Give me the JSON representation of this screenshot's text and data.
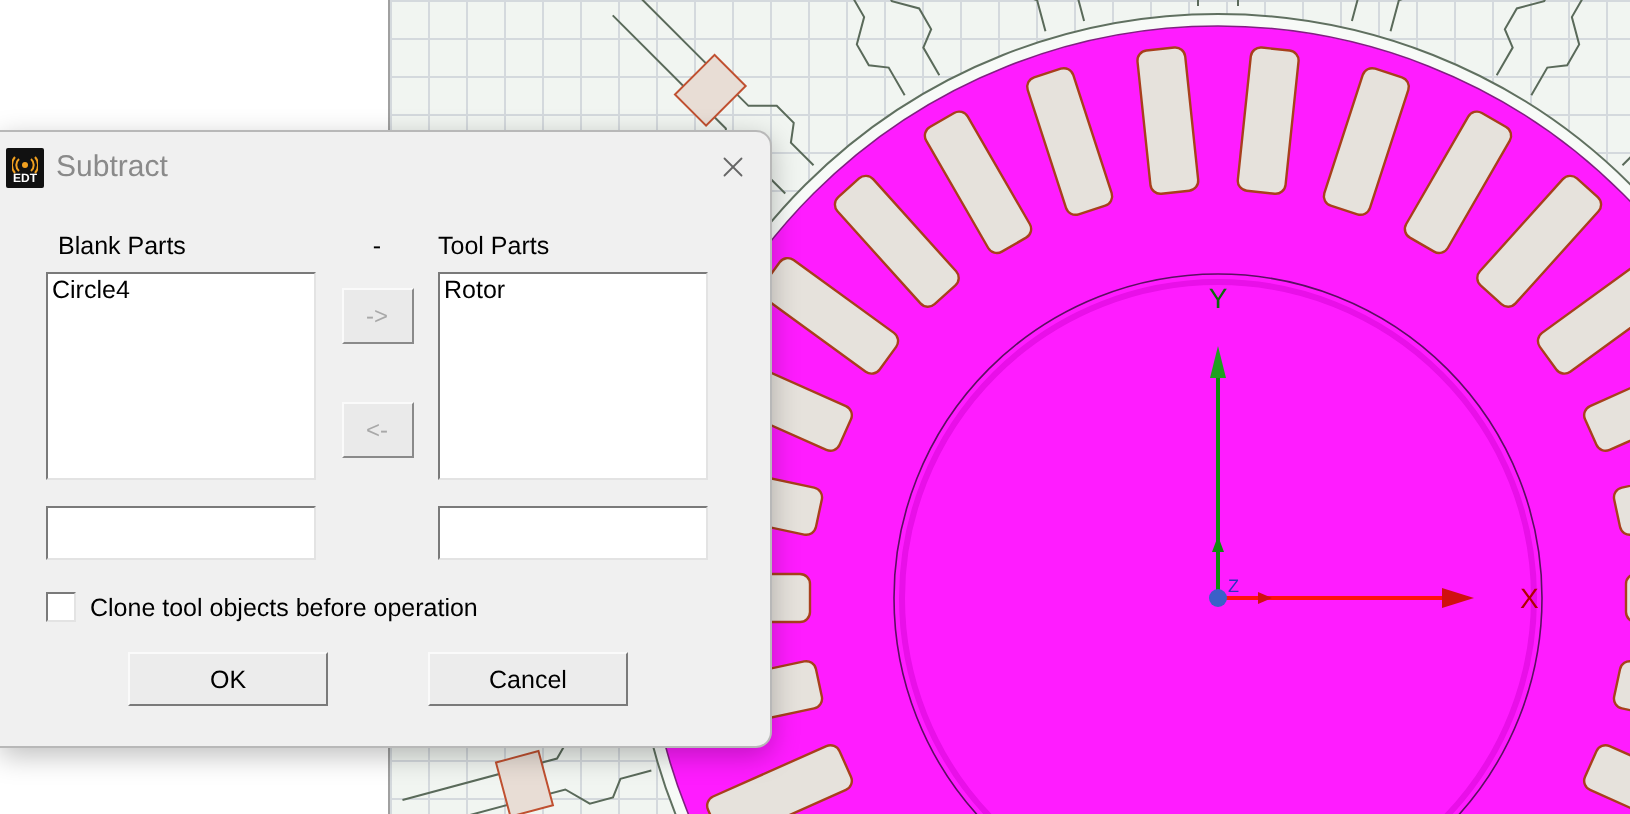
{
  "viewport": {
    "axis_labels": [
      {
        "text": "Y"
      },
      {
        "text": "Z"
      },
      {
        "text": "X"
      }
    ]
  },
  "dialog": {
    "logo_text": "EDT",
    "title": "Subtract",
    "blank_parts": {
      "label": "Blank Parts",
      "items": [
        {
          "text": "Circle4",
          "selected": false
        }
      ]
    },
    "operator": "-",
    "tool_parts": {
      "label": "Tool Parts",
      "items": [
        {
          "text": "Rotor",
          "selected": false
        }
      ]
    },
    "move_buttons": [
      {
        "text": "->",
        "disabled": true
      },
      {
        "text": "<-",
        "disabled": true
      }
    ],
    "clone_option": {
      "label": "Clone tool objects before operation",
      "checked": false
    },
    "buttons": [
      {
        "text": "OK"
      },
      {
        "text": "Cancel"
      }
    ]
  }
}
